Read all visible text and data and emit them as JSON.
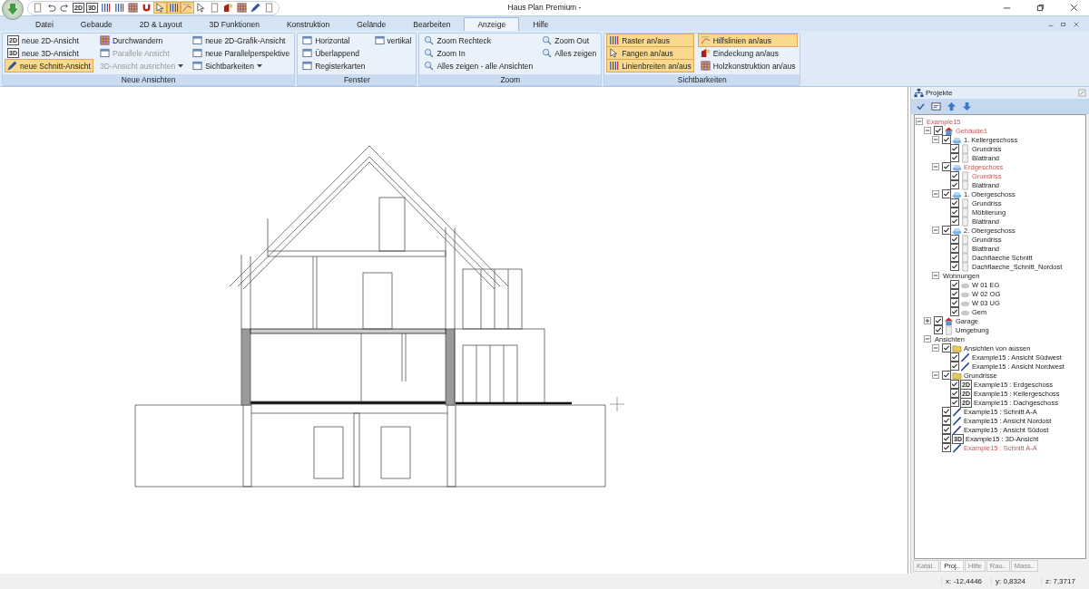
{
  "window": {
    "title": "Haus Plan Premium -"
  },
  "quick_access": [
    {
      "kind": "page"
    },
    {
      "kind": "undo"
    },
    {
      "kind": "redo"
    },
    {
      "kind": "badge",
      "text": "2D"
    },
    {
      "kind": "badge",
      "text": "3D"
    },
    {
      "kind": "lines"
    },
    {
      "kind": "lines"
    },
    {
      "kind": "grid"
    },
    {
      "kind": "magnet"
    },
    {
      "kind": "cursor",
      "selected": true
    },
    {
      "kind": "lines",
      "selected": true
    },
    {
      "kind": "guide",
      "selected": true
    },
    {
      "kind": "cursor",
      "selected": false
    },
    {
      "kind": "page"
    },
    {
      "kind": "roof"
    },
    {
      "kind": "grid"
    },
    {
      "kind": "pen"
    },
    {
      "kind": "page"
    }
  ],
  "tabs": [
    {
      "label": "Datei",
      "selected": false
    },
    {
      "label": "Gebaude",
      "selected": false
    },
    {
      "label": "2D & Layout",
      "selected": false
    },
    {
      "label": "3D Funktionen",
      "selected": false
    },
    {
      "label": "Konstruktion",
      "selected": false
    },
    {
      "label": "Gelände",
      "selected": false
    },
    {
      "label": "Bearbeiten",
      "selected": false
    },
    {
      "label": "Anzeige",
      "selected": true
    },
    {
      "label": "Hilfe",
      "selected": false
    }
  ],
  "ribbon_groups": [
    {
      "label": "Neue Ansichten",
      "items": [
        {
          "label": "neue 2D-Ansicht",
          "kind": "badge",
          "badge": "2D",
          "highlighted": false,
          "disabled": false
        },
        {
          "label": "neue 3D-Ansicht",
          "kind": "badge",
          "badge": "3D",
          "highlighted": false,
          "disabled": false
        },
        {
          "label": "neue Schnitt-Ansicht",
          "kind": "pen",
          "highlighted": true,
          "disabled": false
        },
        {
          "label": "Durchwandern",
          "kind": "grid",
          "highlighted": false,
          "disabled": false
        },
        {
          "label": "Parallele Ansicht",
          "kind": "window",
          "highlighted": false,
          "disabled": true
        },
        {
          "label": "3D-Ansicht ausrichten",
          "highlighted": false,
          "disabled": true,
          "dropdown": true
        },
        {
          "label": "neue 2D-Grafik-Ansicht",
          "kind": "window",
          "highlighted": false,
          "disabled": false
        },
        {
          "label": "neue Parallelperspektive",
          "kind": "window",
          "highlighted": false,
          "disabled": false
        },
        {
          "label": "Sichtbarkeiten",
          "kind": "window",
          "highlighted": false,
          "disabled": false,
          "dropdown": true
        }
      ]
    },
    {
      "label": "Fenster",
      "items": [
        {
          "label": "Horizontal",
          "kind": "window",
          "highlighted": false,
          "disabled": false
        },
        {
          "label": "Überlappend",
          "kind": "window",
          "highlighted": false,
          "disabled": false
        },
        {
          "label": "Registerkarten",
          "kind": "window",
          "highlighted": false,
          "disabled": false
        },
        {
          "label": "vertikal",
          "kind": "window",
          "highlighted": false,
          "disabled": false
        }
      ]
    },
    {
      "label": "Zoom",
      "items": [
        {
          "label": "Zoom Rechteck",
          "kind": "magnifier",
          "highlighted": false,
          "disabled": false
        },
        {
          "label": "Zoom In",
          "kind": "magnifier",
          "highlighted": false,
          "disabled": false
        },
        {
          "label": "Alles zeigen - alle Ansichten",
          "kind": "magnifier",
          "highlighted": false,
          "disabled": false
        },
        {
          "label": "Zoom Out",
          "kind": "magnifier",
          "highlighted": false,
          "disabled": false
        },
        {
          "label": "Alles zeigen",
          "kind": "magnifier",
          "highlighted": false,
          "disabled": false
        }
      ]
    },
    {
      "label": "Sichtbarkeiten",
      "items": [
        {
          "label": "Raster an/aus",
          "kind": "lines",
          "highlighted": true,
          "disabled": false
        },
        {
          "label": "Fangen an/aus",
          "kind": "cursor",
          "highlighted": true,
          "disabled": false
        },
        {
          "label": "Linienbreiten an/aus",
          "kind": "lines",
          "highlighted": true,
          "disabled": false
        },
        {
          "label": "Hilfslinien an/aus",
          "kind": "guide",
          "highlighted": true,
          "disabled": false
        },
        {
          "label": "Eindeckung an/aus",
          "kind": "roof",
          "highlighted": false,
          "disabled": false
        },
        {
          "label": "Holzkonstruktion an/aus",
          "kind": "grid",
          "highlighted": false,
          "disabled": false
        }
      ]
    }
  ],
  "projects": {
    "title": "Projekte",
    "tree": [
      {
        "label": "Example15",
        "active": true,
        "expanded": true,
        "children": [
          {
            "label": "Gebäude1",
            "kind": "building",
            "checked": true,
            "active": true,
            "expanded": true,
            "children": [
              {
                "label": "1. Kellergeschoss",
                "kind": "floor",
                "checked": true,
                "active": false,
                "expanded": true,
                "children": [
                  {
                    "label": "Grundriss",
                    "kind": "sheet",
                    "checked": true,
                    "active": false
                  },
                  {
                    "label": "Blattrand",
                    "kind": "sheet",
                    "checked": true,
                    "active": false
                  }
                ]
              },
              {
                "label": "Erdgeschoss",
                "kind": "floor",
                "checked": true,
                "active": true,
                "expanded": true,
                "children": [
                  {
                    "label": "Grundriss",
                    "kind": "sheet",
                    "checked": true,
                    "active": true
                  },
                  {
                    "label": "Blattrand",
                    "kind": "sheet",
                    "checked": true,
                    "active": false
                  }
                ]
              },
              {
                "label": "1. Obergeschoss",
                "kind": "floor",
                "checked": true,
                "active": false,
                "expanded": true,
                "children": [
                  {
                    "label": "Grundriss",
                    "kind": "sheet",
                    "checked": true,
                    "active": false
                  },
                  {
                    "label": "Möblierung",
                    "kind": "sheet",
                    "checked": true,
                    "active": false
                  },
                  {
                    "label": "Blattrand",
                    "kind": "sheet",
                    "checked": true,
                    "active": false
                  }
                ]
              },
              {
                "label": "2. Obergeschoss",
                "kind": "floor",
                "checked": true,
                "active": false,
                "expanded": true,
                "children": [
                  {
                    "label": "Grundriss",
                    "kind": "sheet",
                    "checked": true,
                    "active": false
                  },
                  {
                    "label": "Blattrand",
                    "kind": "sheet",
                    "checked": true,
                    "active": false
                  },
                  {
                    "label": "Dachflaeche Schnitt",
                    "kind": "sheet",
                    "checked": true,
                    "active": false
                  },
                  {
                    "label": "Dachflaeche_Schnitt_Nordost",
                    "kind": "sheet",
                    "checked": true,
                    "active": false
                  }
                ]
              },
              {
                "label": "Wohnungen",
                "active": false,
                "expanded": true,
                "children": [
                  {
                    "label": "W 01 EG",
                    "kind": "apartment",
                    "checked": true,
                    "active": false
                  },
                  {
                    "label": "W 02 OG",
                    "kind": "apartment",
                    "checked": true,
                    "active": false
                  },
                  {
                    "label": "W 03 UG",
                    "kind": "apartment",
                    "checked": true,
                    "active": false
                  },
                  {
                    "label": "Gem",
                    "kind": "apartment",
                    "checked": true,
                    "active": false
                  }
                ]
              }
            ]
          },
          {
            "label": "Garage",
            "kind": "building",
            "checked": true,
            "active": false,
            "expanded": false
          },
          {
            "label": "Umgebung",
            "kind": "sheet",
            "checked": true,
            "active": false
          },
          {
            "label": "Ansichten",
            "active": false,
            "expanded": true,
            "children": [
              {
                "label": "Ansichten von aussen",
                "kind": "folder",
                "checked": true,
                "active": false,
                "expanded": true,
                "children": [
                  {
                    "label": "Example15 : Ansicht Südwest",
                    "kind": "line",
                    "checked": true,
                    "active": false
                  },
                  {
                    "label": "Example15 : Ansicht Nordwest",
                    "kind": "line",
                    "checked": true,
                    "active": false
                  }
                ]
              },
              {
                "label": "Grundrisse",
                "kind": "folder",
                "checked": true,
                "active": false,
                "expanded": true,
                "children": [
                  {
                    "label": "Example15 : Erdgeschoss",
                    "kind": "badge",
                    "badge": "2D",
                    "checked": true,
                    "active": false
                  },
                  {
                    "label": "Example15 : Kellergeschoss",
                    "kind": "badge",
                    "badge": "2D",
                    "checked": true,
                    "active": false
                  },
                  {
                    "label": "Example15 : Dachgeschoss",
                    "kind": "badge",
                    "badge": "2D",
                    "checked": true,
                    "active": false
                  }
                ]
              },
              {
                "label": "Example15 : Schnitt A-A",
                "kind": "line",
                "checked": true,
                "active": false
              },
              {
                "label": "Example15 : Ansicht Nordost",
                "kind": "line",
                "checked": true,
                "active": false
              },
              {
                "label": "Example15 : Ansicht Südost",
                "kind": "line",
                "checked": true,
                "active": false
              },
              {
                "label": "Example15 : 3D-Ansicht",
                "kind": "badge",
                "badge": "3D",
                "checked": true,
                "active": false
              },
              {
                "label": "Example15 : Schnitt A-A",
                "kind": "line",
                "checked": true,
                "active": true
              }
            ]
          }
        ]
      }
    ]
  },
  "panel_tabs": [
    {
      "label": "Katal..",
      "selected": false
    },
    {
      "label": "Proj..",
      "selected": true
    },
    {
      "label": "Hilfe",
      "selected": false
    },
    {
      "label": "Rau..",
      "selected": false
    },
    {
      "label": "Mass..",
      "selected": false
    }
  ],
  "status_bar": {
    "x": "x: -12,4446",
    "y": "y: 0,8324",
    "z": "z: 7,3717"
  }
}
